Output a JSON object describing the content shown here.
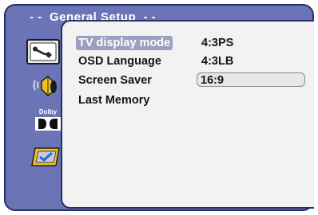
{
  "header": {
    "title": "- -  General Setup  - -"
  },
  "sidebar": {
    "icons": [
      {
        "name": "general-setup-icon",
        "active": true
      },
      {
        "name": "speaker-icon"
      },
      {
        "name": "dolby-icon",
        "label": "Dolby"
      },
      {
        "name": "preference-icon"
      }
    ]
  },
  "menu": {
    "items": [
      {
        "label": "TV display mode",
        "selected": true
      },
      {
        "label": "OSD Language"
      },
      {
        "label": "Screen Saver"
      },
      {
        "label": "Last Memory"
      }
    ]
  },
  "options": {
    "items": [
      {
        "label": "4:3PS"
      },
      {
        "label": "4:3LB"
      },
      {
        "label": "16:9",
        "current": true
      }
    ]
  },
  "colors": {
    "frame": "#6b74b6",
    "panel": "#f2f2f2",
    "highlight": "#9aa0bf",
    "border": "#2a2f63"
  }
}
